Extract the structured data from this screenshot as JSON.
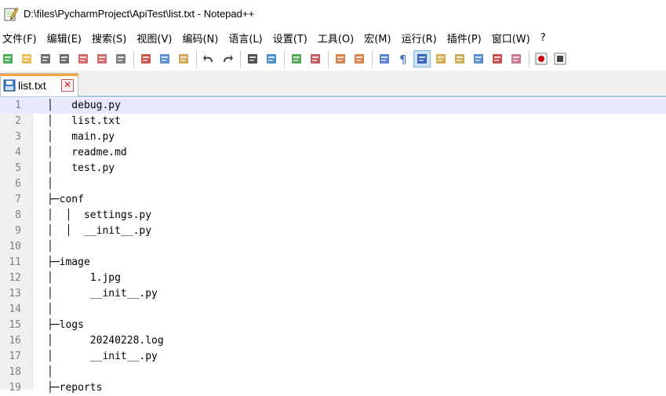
{
  "window": {
    "title": "D:\\files\\PycharmProject\\ApiTest\\list.txt - Notepad++"
  },
  "menu": [
    "文件(F)",
    "编辑(E)",
    "搜索(S)",
    "视图(V)",
    "编码(N)",
    "语言(L)",
    "设置(T)",
    "工具(O)",
    "宏(M)",
    "运行(R)",
    "插件(P)",
    "窗口(W)",
    "?"
  ],
  "toolbar": {
    "icons": [
      "new-file-icon",
      "open-file-icon",
      "save-icon",
      "save-all-icon",
      "close-icon",
      "close-all-icon",
      "print-icon",
      "|",
      "cut-icon",
      "copy-icon",
      "paste-icon",
      "|",
      "undo-icon",
      "redo-icon",
      "|",
      "find-icon",
      "replace-icon",
      "|",
      "zoom-in-icon",
      "zoom-out-icon",
      "|",
      "sync-vertical-icon",
      "sync-horizontal-icon",
      "|",
      "word-wrap-icon",
      "show-all-chars-icon",
      "indent-guide-icon",
      "doc-map-icon",
      "function-list-icon",
      "folder-workspace-icon",
      "doc-list-icon",
      "monitor-icon",
      "|",
      "record-macro-icon",
      "stop-macro-icon"
    ],
    "active_icon": "indent-guide-icon"
  },
  "tab": {
    "label": "list.txt",
    "close": "✕"
  },
  "editor": {
    "current_line": 1,
    "lines": [
      {
        "n": "1",
        "text": "│   debug.py"
      },
      {
        "n": "2",
        "text": "│   list.txt"
      },
      {
        "n": "3",
        "text": "│   main.py"
      },
      {
        "n": "4",
        "text": "│   readme.md"
      },
      {
        "n": "5",
        "text": "│   test.py"
      },
      {
        "n": "6",
        "text": "│"
      },
      {
        "n": "7",
        "text": "├─conf"
      },
      {
        "n": "8",
        "text": "│  │  settings.py"
      },
      {
        "n": "9",
        "text": "│  │  __init__.py"
      },
      {
        "n": "10",
        "text": "│"
      },
      {
        "n": "11",
        "text": "├─image"
      },
      {
        "n": "12",
        "text": "│      1.jpg"
      },
      {
        "n": "13",
        "text": "│      __init__.py"
      },
      {
        "n": "14",
        "text": "│"
      },
      {
        "n": "15",
        "text": "├─logs"
      },
      {
        "n": "16",
        "text": "│      20240228.log"
      },
      {
        "n": "17",
        "text": "│      __init__.py"
      },
      {
        "n": "18",
        "text": "│"
      },
      {
        "n": "19",
        "text": "├─reports"
      }
    ]
  }
}
